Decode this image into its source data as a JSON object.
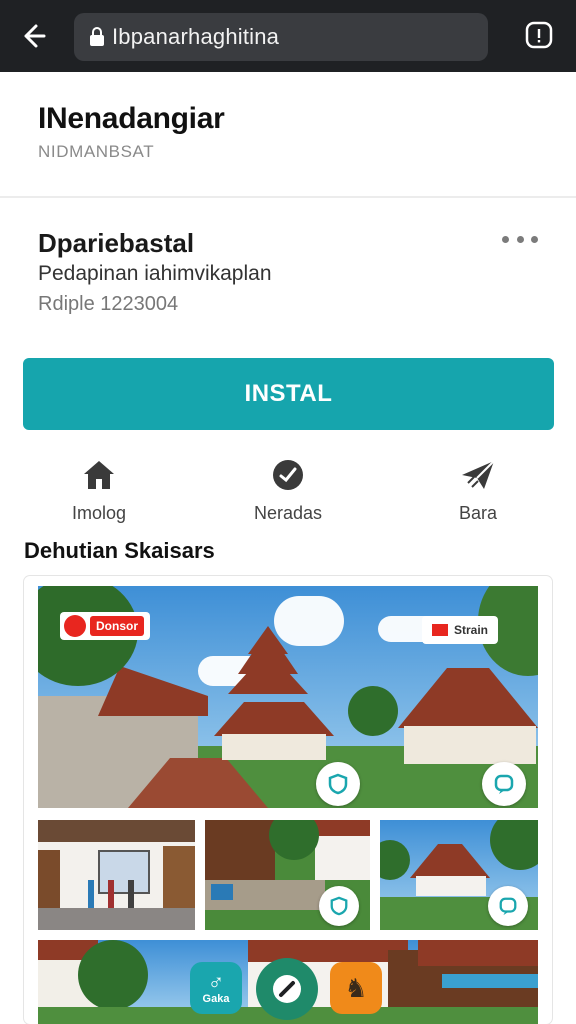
{
  "browser": {
    "url": "Ibpanarhaghitina"
  },
  "header": {
    "title": "INenadangiar",
    "subtitle": "NIDMANBSAT"
  },
  "app": {
    "name": "Dpariebastal",
    "description": "Pedapinan iahimvikaplan",
    "meta": "Rdiple 1223004"
  },
  "install": {
    "label": "INSTAL"
  },
  "actions": [
    {
      "label": "Imolog",
      "icon": "home-icon"
    },
    {
      "label": "Neradas",
      "icon": "badge-icon"
    },
    {
      "label": "Bara",
      "icon": "send-icon"
    }
  ],
  "section": {
    "title": "Dehutian Skaisars"
  },
  "gallery": {
    "badge_left": "Donsor",
    "badge_right": "Strain",
    "dock_left_label": "Gaka",
    "dock_left_glyph": "♂",
    "dock_right_glyph": "♞"
  },
  "colors": {
    "accent": "#16a5ad",
    "topbar": "#1f2124",
    "roof": "#8e3a26"
  }
}
